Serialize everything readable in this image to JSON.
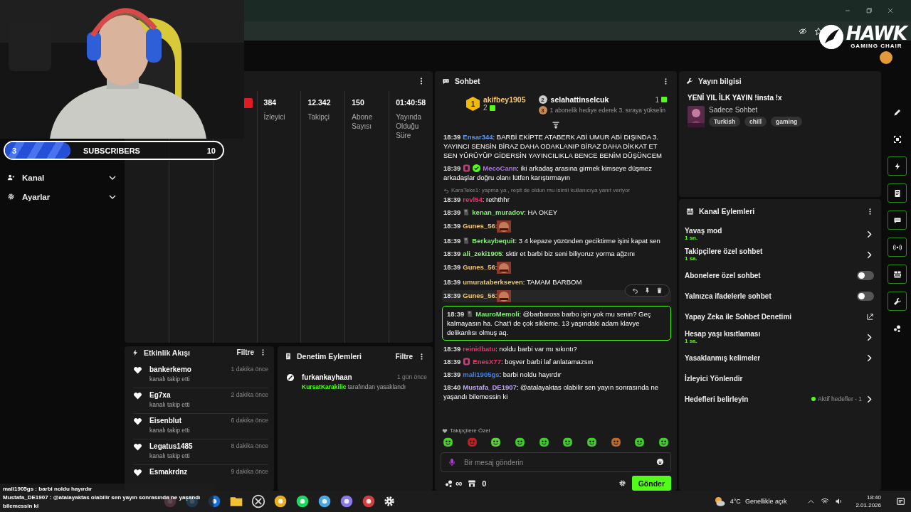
{
  "overlay": {
    "subscribers": {
      "current": "3",
      "label": "SUBSCRIBERS",
      "goal": "10",
      "level": 0.3
    },
    "logo": {
      "name": "HAWK",
      "tagline": "GAMING CHAIR"
    },
    "chat_lines": [
      {
        "user": "mali1905gs",
        "text": " : barbi noldu hayırdır"
      },
      {
        "user": "Mustafa_DE1907",
        "text": " : @atalayaktas olabilir sen yayın sonrasında ne yaşandı bilemessin ki"
      }
    ]
  },
  "sidebar": {
    "items": [
      {
        "label": "Kanal",
        "expanded": false
      },
      {
        "label": "Ayarlar",
        "expanded": false
      }
    ]
  },
  "stats": {
    "items": [
      {
        "value": "384",
        "label": "İzleyici"
      },
      {
        "value": "12.342",
        "label": "Takipçi"
      },
      {
        "value": "150",
        "label": "Abone Sayısı"
      },
      {
        "value": "01:40:58",
        "label": "Yayında Olduğu Süre"
      }
    ]
  },
  "activity": {
    "title": "Etkinlik Akışı",
    "filter": "Filtre",
    "items": [
      {
        "user": "bankerkemo",
        "action": "kanalı takip etti",
        "time": "1 dakika önce"
      },
      {
        "user": "Eg7xa",
        "action": "kanalı takip etti",
        "time": "2 dakika önce"
      },
      {
        "user": "Eisenblut",
        "action": "kanalı takip etti",
        "time": "6 dakika önce"
      },
      {
        "user": "Legatus1485",
        "action": "kanalı takip etti",
        "time": "8 dakika önce"
      },
      {
        "user": "Esmakrdnz",
        "time": "9 dakika önce"
      }
    ]
  },
  "moderation": {
    "title": "Denetim Eylemleri",
    "filter": "Filtre",
    "items": [
      {
        "user": "furkankayhaan",
        "moderator": "KursatKarakilic",
        "action": " tarafından yasaklandı",
        "time": "1 gün önce"
      }
    ]
  },
  "chat": {
    "title": "Sohbet",
    "leaders": [
      {
        "rank": "1",
        "user": "akifbey1905",
        "count": "2"
      },
      {
        "rank": "2",
        "user": "selahattinselcuk",
        "count": "1"
      }
    ],
    "next_rank": {
      "rank": "3",
      "text": "1 abonelik hediye ederek 3. sıraya yükselin"
    },
    "messages": [
      {
        "time": "18:39",
        "user": "Ensar344",
        "color": "#5f9cf5",
        "kind": "text",
        "text": ": BARBİ EKİPTE ATABERK ABİ UMUR ABİ DIŞINDA 3. YAYINCI SENSİN BİRAZ DAHA ODAKLANIP BİRAZ DAHA DİKKAT ET SEN YÜRÜYÜP GİDERSİN YAYINCILIKLA BENCE BENİM DÜŞÜNCEM",
        "highlighted": false,
        "hovered": false
      },
      {
        "time": "18:39",
        "user": "MecoCann",
        "color": "#b46ef7",
        "badges": [
          {
            "kind": "letter"
          },
          {
            "kind": "verified"
          }
        ],
        "kind": "text",
        "text": ": iki arkadaş arasına girmek kimseye düşmez arkadaşlar doğru olanı lütfen karıştırmayın",
        "highlighted": false,
        "hovered": false
      },
      {
        "time": "18:39",
        "user": "revl54",
        "color": "#e8356b",
        "kind": "text",
        "reply_to": "KaraTeke1: yapma ya , reşit de oldun mu isimli kullanıcıya yanıt veriyor",
        "text": ": reththhr",
        "highlighted": false,
        "hovered": false
      },
      {
        "time": "18:39",
        "user": "kenan_muradov",
        "color": "#7df36f",
        "badges": [
          {
            "kind": "sub"
          }
        ],
        "kind": "text",
        "text": ": HA OKEY",
        "highlighted": false,
        "hovered": false
      },
      {
        "time": "18:39",
        "user": "Gunes_56",
        "color": "#f2c779",
        "kind": "emote",
        "text": ":",
        "highlighted": false,
        "hovered": false
      },
      {
        "time": "18:39",
        "user": "Berkaybequit",
        "color": "#7df36f",
        "badges": [
          {
            "kind": "sub"
          }
        ],
        "kind": "text",
        "text": ": 3 4 kepaze yüzünden geciktirme işini kapat sen",
        "highlighted": false,
        "hovered": false
      },
      {
        "time": "18:39",
        "user": "ali_zeki1905",
        "color": "#8ff27c",
        "kind": "text",
        "text": ": sktir et barbi biz seni biliyoruz yorma ağzını",
        "highlighted": false,
        "hovered": false
      },
      {
        "time": "18:39",
        "user": "Gunes_56",
        "color": "#f2c779",
        "kind": "emote",
        "text": ":",
        "highlighted": false,
        "hovered": false
      },
      {
        "time": "18:39",
        "user": "umurataberkseven",
        "color": "#e8c56d",
        "kind": "text",
        "text": ": TAMAM BARBOM",
        "highlighted": false,
        "hovered": false
      },
      {
        "time": "18:39",
        "user": "Gunes_56",
        "color": "#f2c779",
        "kind": "emote",
        "text": ":",
        "highlighted": false,
        "hovered": true
      },
      {
        "time": "18:39",
        "user": "MauroMemoli",
        "color": "#7df36f",
        "badges": [
          {
            "kind": "sub"
          }
        ],
        "kind": "text",
        "text": ": @barbaross barbo işin yok mu senin? Geç kalmayasın ha. Chat'i de çok sikleme. 13 yaşındaki adam klavye delikanlısı olmuş aq.",
        "highlighted": true,
        "hovered": false
      },
      {
        "time": "18:39",
        "user": "reinidbatu",
        "color": "#e8356b",
        "kind": "text",
        "text": ": noldu barbi var mı sıkıntı?",
        "highlighted": false,
        "hovered": false
      },
      {
        "time": "18:39",
        "user": "EnesX77",
        "color": "#e8356b",
        "badges": [
          {
            "kind": "letter"
          }
        ],
        "kind": "text",
        "text": ": boşver barbi laf anlatamazsın",
        "highlighted": false,
        "hovered": false
      },
      {
        "time": "18:39",
        "user": "mali1905gs",
        "color": "#3f82f0",
        "kind": "text",
        "text": ": barbi noldu hayırdır",
        "highlighted": false,
        "hovered": false
      },
      {
        "time": "18:40",
        "user": "Mustafa_DE1907",
        "color": "#c3a6f7",
        "kind": "text",
        "text": ": @atalayaktas olabilir sen yayın sonrasında ne yaşandı bilemessin ki",
        "highlighted": false,
        "hovered": false
      }
    ],
    "emote_section": "Takipçilere Özel",
    "input": {
      "placeholder": "Bir mesaj gönderin"
    },
    "kicks": "∞",
    "store_count": "0",
    "send": "Gönder"
  },
  "stream_info": {
    "title": "Yayın bilgisi",
    "stream_title": "YENİ YIL İLK YAYIN !insta !x",
    "category": "Sadece Sohbet",
    "tags": [
      "Turkish",
      "chill",
      "gaming"
    ]
  },
  "channel_actions": {
    "title": "Kanal Eylemleri",
    "items": [
      {
        "kind": "link",
        "label": "Yavaş mod",
        "value": "1 sn."
      },
      {
        "kind": "link",
        "label": "Takipçilere özel sohbet",
        "value": "1 sa."
      },
      {
        "kind": "toggle",
        "label": "Abonelere özel sohbet",
        "on": false
      },
      {
        "kind": "toggle",
        "label": "Yalnızca ifadelerle sohbet",
        "on": false
      },
      {
        "kind": "external",
        "label": "Yapay Zeka ile Sohbet Denetimi"
      },
      {
        "kind": "link",
        "label": "Hesap yaşı kısıtlaması",
        "value": "1 sa."
      },
      {
        "kind": "link",
        "label": "Yasaklanmış kelimeler"
      },
      {
        "kind": "plain",
        "label": "İzleyici Yönlendir"
      },
      {
        "kind": "goal",
        "label": "Hedefleri belirleyin",
        "status": "Aktif hedefler - 1"
      }
    ]
  },
  "rail": [
    {
      "kind": "pencil",
      "active": false
    },
    {
      "kind": "focus",
      "active": false
    },
    {
      "kind": "bolt",
      "active": true
    },
    {
      "kind": "doc",
      "active": true
    },
    {
      "kind": "chat",
      "active": true
    },
    {
      "kind": "broadcast",
      "active": true
    },
    {
      "kind": "layout",
      "active": true
    },
    {
      "kind": "wrench",
      "active": true
    },
    {
      "kind": "dots",
      "active": false
    }
  ],
  "taskbar": {
    "temperature": "4°C",
    "weather": "Genellikle açık",
    "time": "18:40",
    "date": "2.01.2026"
  }
}
